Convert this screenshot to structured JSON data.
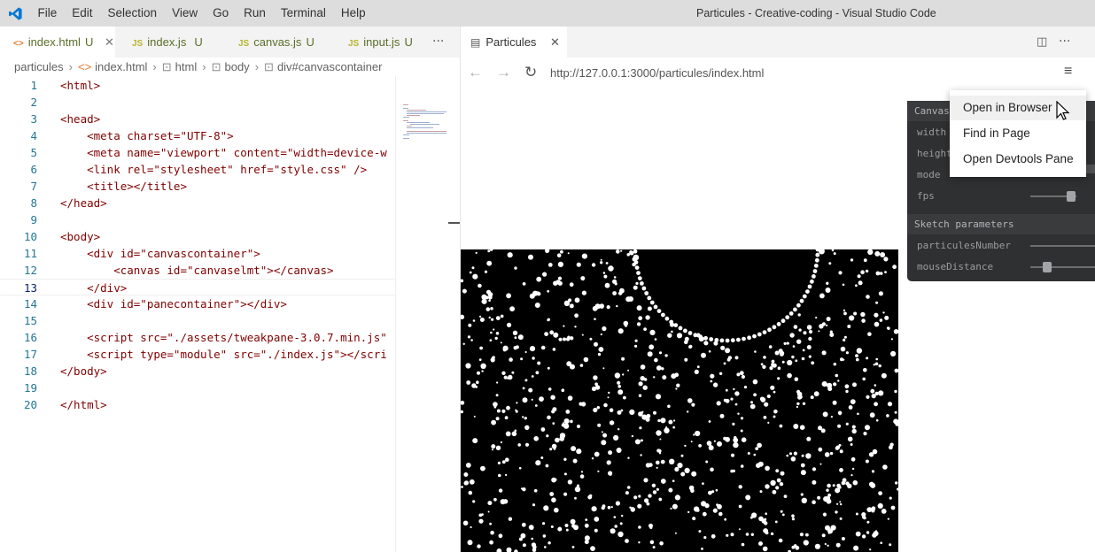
{
  "window": {
    "title": "Particules - Creative-coding - Visual Studio Code",
    "menu": [
      "File",
      "Edit",
      "Selection",
      "View",
      "Go",
      "Run",
      "Terminal",
      "Help"
    ]
  },
  "editor_tabs": [
    {
      "label": "index.html",
      "icon": "<>",
      "status": "U"
    },
    {
      "label": "index.js",
      "icon": "JS",
      "status": "U"
    },
    {
      "label": "canvas.js",
      "icon": "JS",
      "status": "U"
    },
    {
      "label": "input.js",
      "icon": "JS",
      "status": "U"
    }
  ],
  "breadcrumb": [
    "particules",
    "index.html",
    "html",
    "body",
    "div#canvascontainer"
  ],
  "code_lines": [
    {
      "n": "1",
      "text": "<html>"
    },
    {
      "n": "2",
      "text": ""
    },
    {
      "n": "3",
      "text": "<head>"
    },
    {
      "n": "4",
      "text": "    <meta charset=\"UTF-8\">"
    },
    {
      "n": "5",
      "text": "    <meta name=\"viewport\" content=\"width=device-w"
    },
    {
      "n": "6",
      "text": "    <link rel=\"stylesheet\" href=\"style.css\" />"
    },
    {
      "n": "7",
      "text": "    <title></title>"
    },
    {
      "n": "8",
      "text": "</head>"
    },
    {
      "n": "9",
      "text": ""
    },
    {
      "n": "10",
      "text": "<body>"
    },
    {
      "n": "11",
      "text": "    <div id=\"canvascontainer\">"
    },
    {
      "n": "12",
      "text": "        <canvas id=\"canvaselmt\"></canvas>"
    },
    {
      "n": "13",
      "text": "    </div>"
    },
    {
      "n": "14",
      "text": "    <div id=\"panecontainer\"></div>"
    },
    {
      "n": "15",
      "text": ""
    },
    {
      "n": "16",
      "text": "    <script src=\"./assets/tweakpane-3.0.7.min.js\""
    },
    {
      "n": "17",
      "text": "    <script type=\"module\" src=\"./index.js\"></scri"
    },
    {
      "n": "18",
      "text": "</body>"
    },
    {
      "n": "19",
      "text": ""
    },
    {
      "n": "20",
      "text": "</html>"
    }
  ],
  "preview": {
    "tab_label": "Particules",
    "url": "http://127.0.0.1:3000/particules/index.html"
  },
  "pane": {
    "folder1": "Canvas",
    "rows1": [
      "width",
      "height",
      "mode",
      "fps"
    ],
    "folder2": "Sketch parameters",
    "rows2": [
      "particulesNumber",
      "mouseDistance"
    ]
  },
  "context_menu": [
    "Open in Browser",
    "Find in Page",
    "Open Devtools Pane"
  ],
  "colors": {
    "accent": "#007acc",
    "canvas": "#000000",
    "pane": "#2f3031"
  }
}
